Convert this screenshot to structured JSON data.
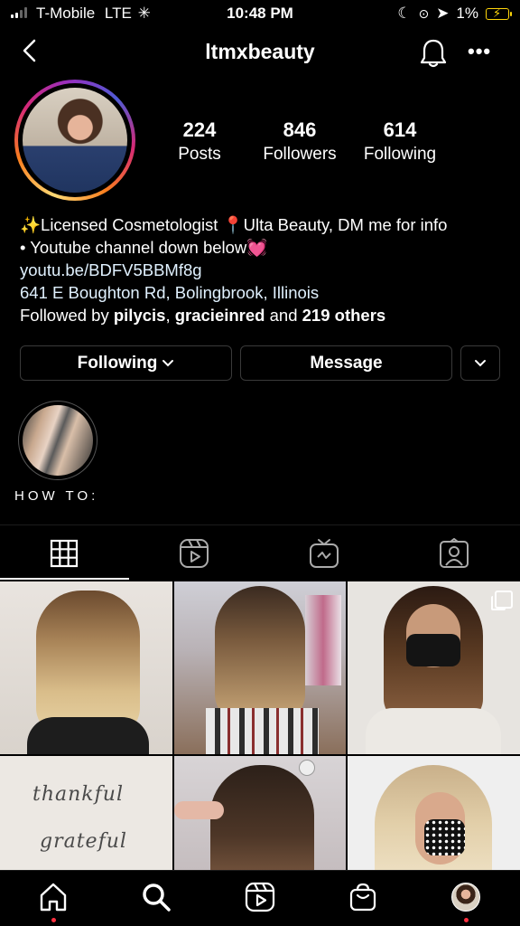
{
  "status_bar": {
    "carrier": "T-Mobile",
    "network": "LTE",
    "time": "10:48 PM",
    "battery": "1%"
  },
  "header": {
    "username": "ltmxbeauty"
  },
  "stats": {
    "posts_count": "224",
    "posts_label": "Posts",
    "followers_count": "846",
    "followers_label": "Followers",
    "following_count": "614",
    "following_label": "Following"
  },
  "bio": {
    "line1": "✨Licensed Cosmetologist 📍Ulta Beauty, DM me for info",
    "line2": "• Youtube channel down below💓",
    "link": "youtu.be/BDFV5BBMf8g",
    "address": "641 E Boughton Rd, Bolingbrook, Illinois",
    "followed_prefix": "Followed by",
    "followed_user1": "pilycis",
    "followed_sep": ",",
    "followed_user2": "gracieinred",
    "followed_and": "and",
    "followed_others": "219 others"
  },
  "actions": {
    "following_label": "Following",
    "message_label": "Message"
  },
  "highlights": [
    {
      "label": "HOW TO:"
    }
  ],
  "grid": {
    "quote_line1": "thankful",
    "quote_line2": "grateful"
  },
  "colors": {
    "background": "#000000",
    "notification_dot": "#ff3040",
    "battery_low": "#ffd60a"
  },
  "icons": {
    "back": "chevron-left",
    "bell": "bell",
    "more": "ellipsis",
    "tab_grid": "grid",
    "tab_reels": "reels",
    "tab_igtv": "igtv",
    "tab_tagged": "tagged",
    "nav_home": "home",
    "nav_search": "search",
    "nav_reels": "reels",
    "nav_shop": "shopping-bag",
    "nav_profile": "avatar"
  }
}
